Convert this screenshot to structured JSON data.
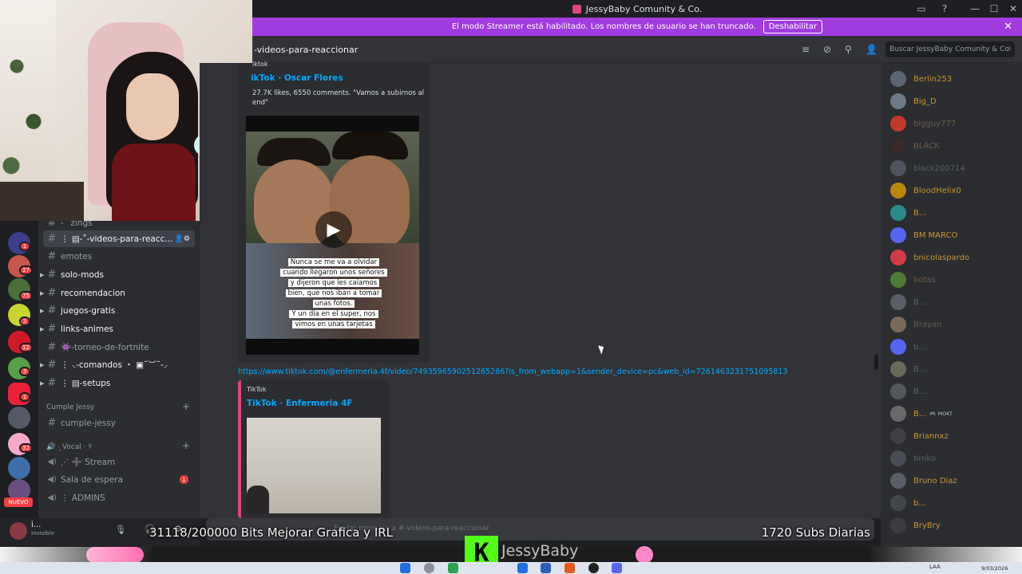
{
  "window": {
    "title": "JessyBaby Comunity & Co.",
    "controls": {
      "minimize": "—",
      "maximize": "☐",
      "close": "✕"
    }
  },
  "banner": {
    "text": "El modo Streamer está habilitado. Los nombres de usuario se han truncado.",
    "button": "Deshabilitar",
    "close": "✕"
  },
  "header": {
    "channel_name": "-videos-para-reaccionar",
    "search_placeholder": "Buscar JessyBaby Comunity & Co.",
    "icons": [
      "threads-icon",
      "mute-icon",
      "pin-icon",
      "members-icon"
    ]
  },
  "servers": {
    "badges": [
      "1",
      "27",
      "75",
      "3",
      "12",
      "3",
      "1",
      "32"
    ],
    "new_label": "NUEVO"
  },
  "channels": [
    {
      "label": "-˚ zings",
      "style": "dim"
    },
    {
      "label": "⋮ ▤-˚-videos-para-reacc...",
      "style": "active"
    },
    {
      "label": "emotes",
      "style": "dim"
    },
    {
      "label": "solo-mods",
      "style": "bright"
    },
    {
      "label": "recomendacion",
      "style": "bright"
    },
    {
      "label": "juegos-gratis",
      "style": "bright"
    },
    {
      "label": "links-animes",
      "style": "bright"
    },
    {
      "label": "👾-torneo-de-fortnite",
      "style": "dim"
    },
    {
      "label": "⋮ ⸜-comandos ・ ▣˘︶˘-⸝",
      "style": "bright"
    },
    {
      "label": "⋮ ▤-setups",
      "style": "bright"
    }
  ],
  "categories": {
    "cumple": "Cumple Jessy",
    "cumple_channel": "cumple-jessy",
    "vocal": "🔊 ·͙ Vocal ⋅ ୨"
  },
  "voice_channels": [
    {
      "label": "⋰ ➕ Stream",
      "badge": ""
    },
    {
      "label": "Sala de espera",
      "badge": "1"
    },
    {
      "label": "⋮ ADMINS",
      "badge": ""
    }
  ],
  "user": {
    "name": "i...",
    "status": "Invisible"
  },
  "messages": {
    "embed1": {
      "provider": "iktok",
      "title": "ikTok · Oscar Flores",
      "description_line1": "27.7K likes, 6550 comments. \"Vamos a subirnos al",
      "description_line2": "end\"",
      "caption": [
        "Nunca se me va a olvidar",
        "cuando llegaron unos señores",
        "y dijeron que les caíamos",
        "bien, que nos iban a tomar",
        "unas fotos.",
        "Y un día en el super, nos",
        "vimos en unas tarjetas"
      ]
    },
    "link": "https://www.tiktok.com/@enfermeria.4f/video/7493596590251265286?is_from_webapp=1&sender_device=pc&web_id=7261463231751095813",
    "embed2": {
      "provider": "TikTok",
      "title": "TikTok · Enfermeria 4F"
    },
    "input_placeholder": "Enviar mensaje a #-videos-para-reaccionar"
  },
  "members": [
    {
      "name": "Berlin253",
      "color": "#c79432"
    },
    {
      "name": "Big_D",
      "color": "#c79432"
    },
    {
      "name": "bigguy777",
      "color": "#6a5a4a"
    },
    {
      "name": "BLACK",
      "color": "#6a5a4a"
    },
    {
      "name": "black200714",
      "color": "#5a5e66"
    },
    {
      "name": "BloodHelix0",
      "color": "#c79432"
    },
    {
      "name": "B...",
      "color": "#c79432"
    },
    {
      "name": "BM MARCO",
      "color": "#c79432"
    },
    {
      "name": "bnicolaspardo",
      "color": "#c79432"
    },
    {
      "name": "botas",
      "color": "#6a5a4a"
    },
    {
      "name": "B...",
      "color": "#5a5e66"
    },
    {
      "name": "Brayan",
      "color": "#6a5a4a"
    },
    {
      "name": "b...",
      "color": "#5a5e66"
    },
    {
      "name": "B...",
      "color": "#5a5e66"
    },
    {
      "name": "B...",
      "color": "#5a5e66"
    },
    {
      "name": "B...",
      "color": "#c79432",
      "tag": "🎮 MOKT"
    },
    {
      "name": "Briannxz",
      "color": "#c79432"
    },
    {
      "name": "broko",
      "color": "#5a5e66"
    },
    {
      "name": "Bruno Diaz",
      "color": "#c79432"
    },
    {
      "name": "b...",
      "color": "#c79432"
    },
    {
      "name": "BryBry",
      "color": "#c79432"
    }
  ],
  "overlay": {
    "bits_goal": "31118/200000 Bits Mejorar Grafica y IRL",
    "subs": "1720 Subs Diarias",
    "kick_letter": "K",
    "kick_name": "JessyBaby"
  },
  "taskbar": {
    "lang": "LAA",
    "date": "9/03/2026"
  }
}
